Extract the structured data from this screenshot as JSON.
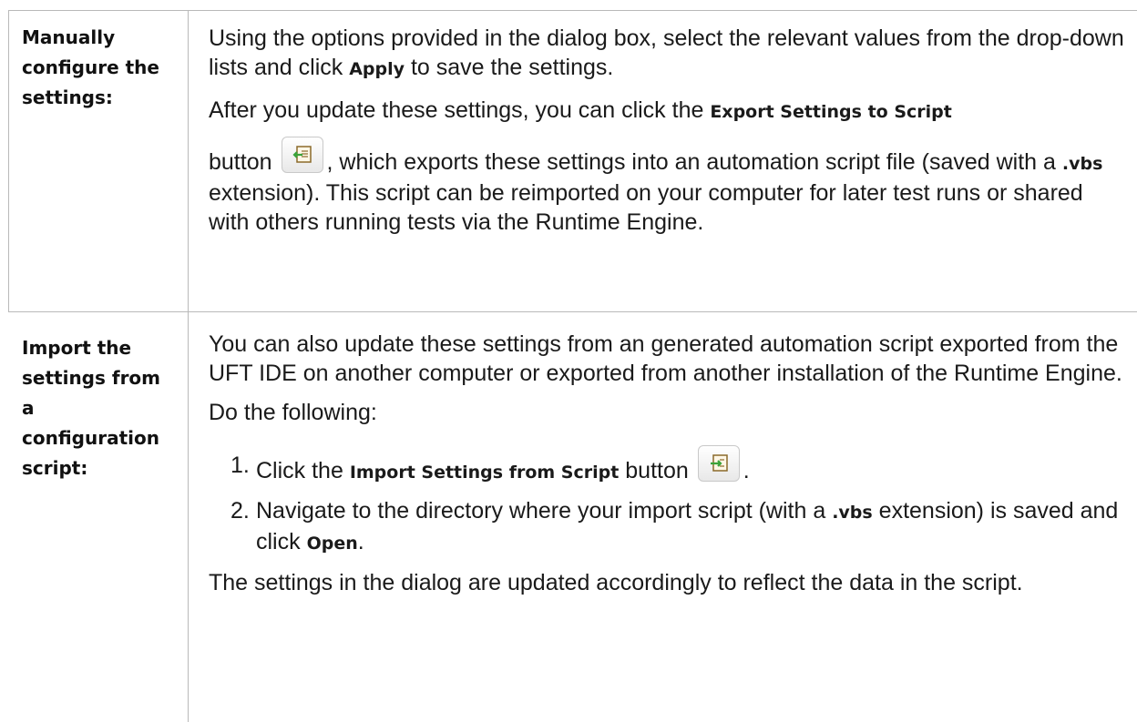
{
  "rows": [
    {
      "label": [
        "Manually",
        "configure the",
        "settings:"
      ],
      "para1": {
        "text1": "Using the options provided in the dialog box, select the relevant values from the drop-down lists and click ",
        "bold": "Apply",
        "text2": " to save the settings."
      },
      "para2": {
        "text1": "After you update these settings, you can click the ",
        "bold1": "Export Settings to Script",
        "text2": "button",
        "icon": "export-settings-icon",
        "text3": ", which exports these settings into an automation script file (saved with a ",
        "bold2": ".vbs",
        "text4": " extension). This script can be reimported on your computer for later test runs or shared with others running tests via the Runtime Engine."
      }
    },
    {
      "label": [
        "Import the",
        "settings from",
        "a",
        "configuration",
        "script:"
      ],
      "para1": "You can also update these settings from an generated automation script exported from the UFT IDE on another computer or exported from another installation of the Runtime Engine.",
      "para2": "Do the following:",
      "steps": [
        {
          "num": "1.",
          "text1": "Click the ",
          "bold": "Import Settings from Script",
          "text2": " button",
          "icon": "import-settings-icon",
          "text3": "."
        },
        {
          "num": "2.",
          "text1": "Navigate to the directory where your import script (with a ",
          "bold1": ".vbs",
          "text2": " extension) is saved and click ",
          "bold2": "Open",
          "text3": "."
        }
      ],
      "para3": "The settings in the dialog are updated accordingly to reflect the data in the script."
    }
  ]
}
